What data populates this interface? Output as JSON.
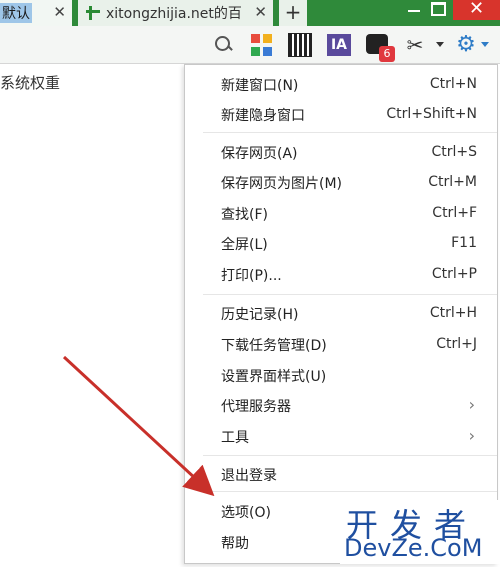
{
  "tabs": [
    {
      "title": "默认"
    },
    {
      "title": "xitongzhijia.net的百"
    }
  ],
  "toolbar": {
    "ia_label": "IA",
    "badge_count": "6",
    "apps_colors": [
      "#e84c3d",
      "#f2b01e",
      "#2fa84f",
      "#3a7bd5"
    ]
  },
  "page": {
    "sidebar_text": "系统权重"
  },
  "menu": {
    "items": [
      {
        "label": "新建窗口(N)",
        "shortcut": "Ctrl+N"
      },
      {
        "label": "新建隐身窗口",
        "shortcut": "Ctrl+Shift+N"
      },
      {
        "label": "保存网页(A)",
        "shortcut": "Ctrl+S"
      },
      {
        "label": "保存网页为图片(M)",
        "shortcut": "Ctrl+M"
      },
      {
        "label": "查找(F)",
        "shortcut": "Ctrl+F"
      },
      {
        "label": "全屏(L)",
        "shortcut": "F11"
      },
      {
        "label": "打印(P)...",
        "shortcut": "Ctrl+P"
      },
      {
        "label": "历史记录(H)",
        "shortcut": "Ctrl+H"
      },
      {
        "label": "下载任务管理(D)",
        "shortcut": "Ctrl+J"
      },
      {
        "label": "设置界面样式(U)",
        "shortcut": ""
      },
      {
        "label": "代理服务器",
        "shortcut": ""
      },
      {
        "label": "工具",
        "shortcut": ""
      },
      {
        "label": "退出登录",
        "shortcut": ""
      },
      {
        "label": "选项(O)",
        "shortcut": ""
      },
      {
        "label": "帮助",
        "shortcut": ""
      }
    ]
  },
  "watermark": {
    "cn": "开发者",
    "en": "DevZe.CoM"
  }
}
